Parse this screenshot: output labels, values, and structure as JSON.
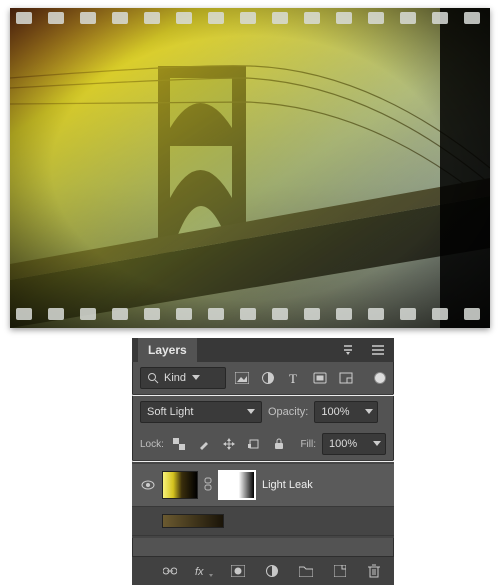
{
  "panel": {
    "title": "Layers",
    "filter_label": "Kind",
    "blend_mode": "Soft Light",
    "opacity_label": "Opacity:",
    "opacity_value": "100%",
    "fill_label": "Fill:",
    "fill_value": "100%",
    "lock_label": "Lock:",
    "layers": [
      {
        "name": "Light Leak",
        "visible": true,
        "selected": true,
        "has_mask": true
      },
      {
        "name": "",
        "visible": false,
        "selected": false,
        "has_mask": false
      }
    ]
  },
  "icons": {
    "search": "search-icon",
    "image": "image-filter-icon",
    "adjust": "adjustment-filter-icon",
    "type": "type-filter-icon",
    "shape": "shape-filter-icon",
    "smart": "smartobj-filter-icon",
    "menu": "panel-menu-icon",
    "collapse": "collapse-icon",
    "lock_pixels": "lock-pixels-icon",
    "lock_brush": "lock-brush-icon",
    "lock_pos": "lock-position-icon",
    "lock_artboard": "lock-artboard-icon",
    "lock_all": "lock-all-icon",
    "link": "link-icon",
    "fx": "fx-icon",
    "addmask": "add-mask-icon",
    "newfill": "new-fill-icon",
    "group": "new-group-icon",
    "new": "new-layer-icon",
    "trash": "trash-icon",
    "eye": "visibility-icon",
    "chevron": "chevron-down-icon"
  }
}
